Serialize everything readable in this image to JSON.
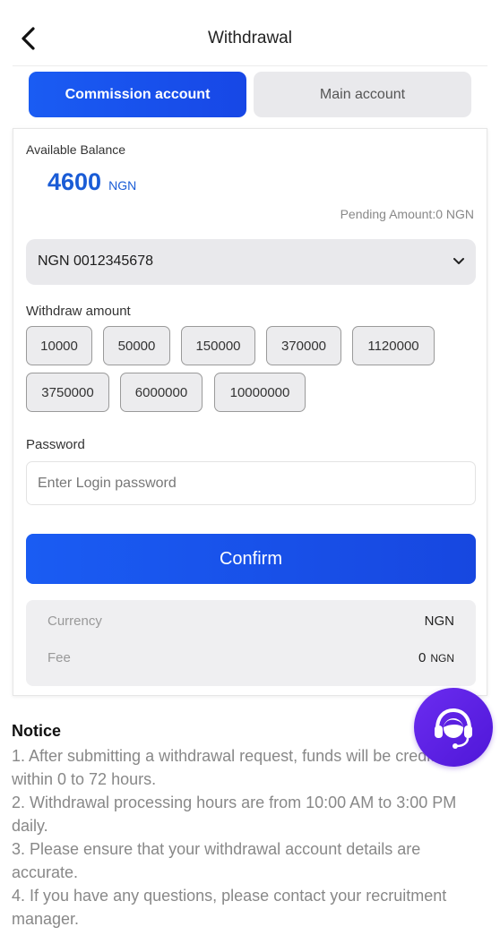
{
  "header": {
    "title": "Withdrawal",
    "back_icon": "chevron-left-icon"
  },
  "tabs": [
    {
      "label": "Commission account",
      "active": true
    },
    {
      "label": "Main account",
      "active": false
    }
  ],
  "balance": {
    "label": "Available Balance",
    "value": "4600",
    "unit": "NGN",
    "pending": "Pending Amount:0 NGN"
  },
  "account_select": {
    "value": "NGN 0012345678",
    "icon": "chevron-down-icon"
  },
  "withdraw": {
    "label": "Withdraw amount",
    "amounts": [
      "10000",
      "50000",
      "150000",
      "370000",
      "1120000",
      "3750000",
      "6000000",
      "10000000"
    ]
  },
  "password": {
    "label": "Password",
    "placeholder": "Enter Login password"
  },
  "confirm_label": "Confirm",
  "summary": {
    "currency_label": "Currency",
    "currency_value": "NGN",
    "fee_label": "Fee",
    "fee_value": "0",
    "fee_unit": "NGN"
  },
  "notice": {
    "title": "Notice",
    "items": [
      "1. After submitting a withdrawal request, funds will be credited within 0 to 72 hours.",
      "2. Withdrawal processing hours are from 10:00 AM to 3:00 PM daily.",
      "3. Please ensure that your withdrawal account details are accurate.",
      "4. If you have any questions, please contact your recruitment manager."
    ]
  },
  "support_icon": "customer-service-headset-icon",
  "colors": {
    "primary": "#1a5cf3",
    "amount": "#1a5cd6",
    "support": "#5a1fe0"
  }
}
